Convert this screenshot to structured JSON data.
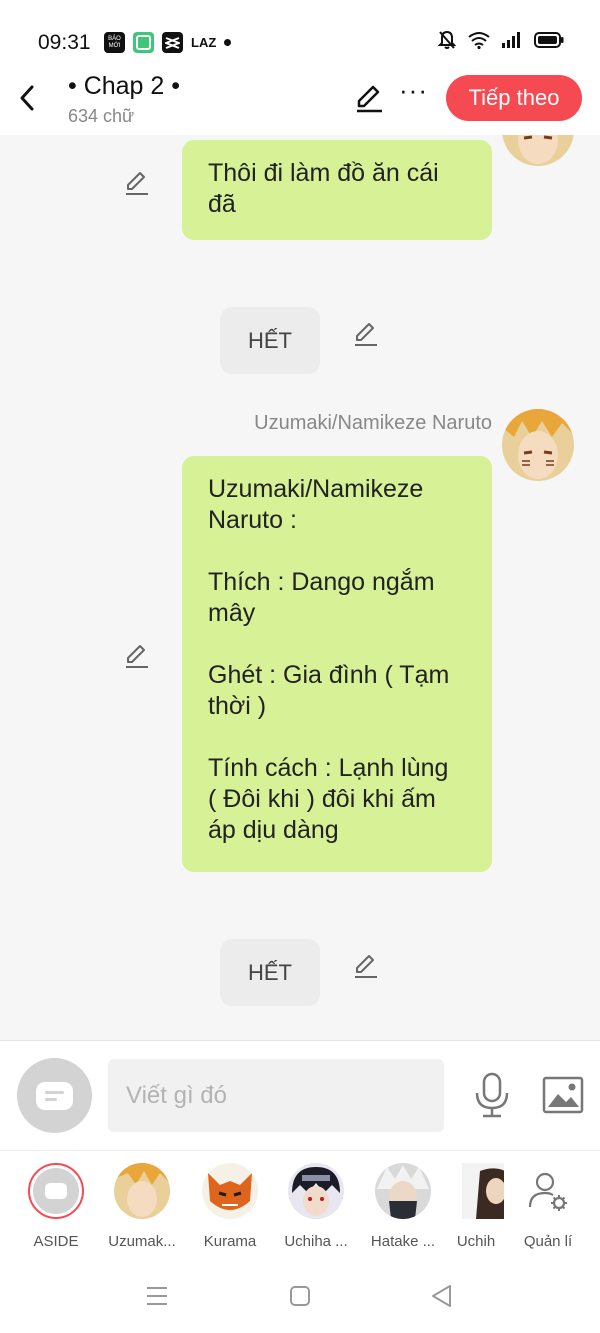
{
  "status_bar": {
    "time": "09:31",
    "app_icons": [
      "BÁO MỚI",
      "green-square-app-icon",
      "capcut-icon",
      "LAZ"
    ]
  },
  "header": {
    "chapter_title": "• Chap 2 •",
    "word_count": "634 chữ",
    "next_button": "Tiếp theo"
  },
  "messages": [
    {
      "type": "bubble",
      "lines": [
        "Thôi đi làm đồ ăn cái",
        "đã"
      ]
    },
    {
      "type": "end",
      "text": "HẾT"
    },
    {
      "type": "bubble",
      "sender": "Uzumaki/Namikeze Naruto",
      "lines": [
        "Uzumaki/Namikeze",
        "Naruto :",
        "",
        "Thích : Dango ngắm",
        "mây",
        "",
        "Ghét : Gia đình ( Tạm",
        "thời )",
        "",
        "Tính cách : Lạnh lùng",
        "( Đôi khi ) đôi khi ấm",
        "áp dịu dàng"
      ]
    },
    {
      "type": "end",
      "text": "HẾT"
    }
  ],
  "input": {
    "placeholder": "Viết gì đó"
  },
  "characters": [
    {
      "name": "ASIDE",
      "icon": "aside-card-icon",
      "selected": true
    },
    {
      "name": "Uzumak..."
    },
    {
      "name": "Kurama"
    },
    {
      "name": "Uchiha ..."
    },
    {
      "name": "Hatake ..."
    },
    {
      "name": "Uchih"
    },
    {
      "name": "Quản lí",
      "icon": "user-settings-icon"
    }
  ],
  "colors": {
    "accent": "#f54a52",
    "bubble": "#d7f196",
    "background": "#f6f6f6"
  }
}
